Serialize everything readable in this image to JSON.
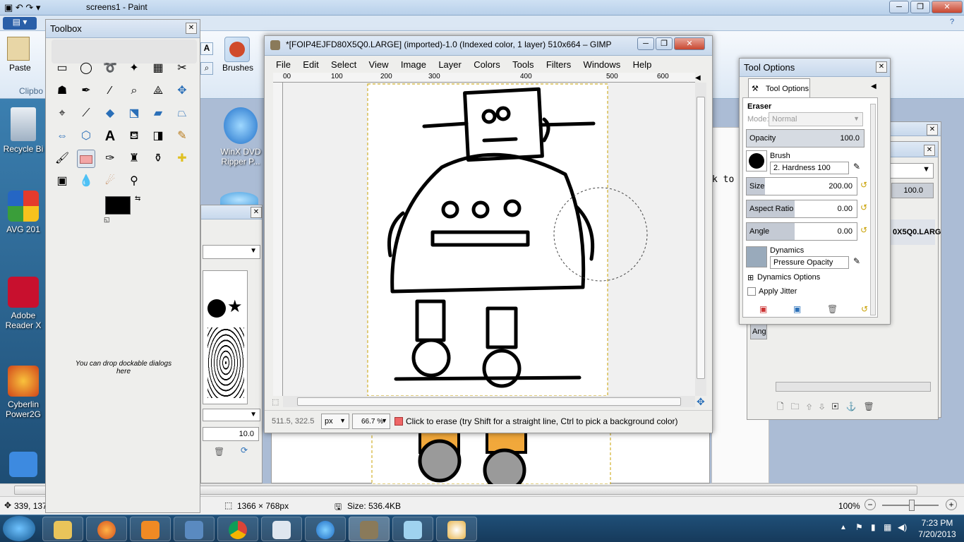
{
  "paint": {
    "title": "screens1 - Paint",
    "tab_home": "",
    "paste_label": "Paste",
    "clipboard_label": "Clipbo",
    "brushes_label": "Brushes",
    "status_cursor": "339, 137",
    "status_size": "1366 × 768px",
    "status_filesize": "Size: 536.4KB",
    "zoom": "100%"
  },
  "desktop": {
    "icons": [
      {
        "label": "Recycle Bi"
      },
      {
        "label": "AVG 201"
      },
      {
        "label": "Adobe Reader X"
      },
      {
        "label": "Cyberlin Power2G"
      }
    ],
    "winx_label": "WinX DVD Ripper P..."
  },
  "toolbox": {
    "title": "Toolbox",
    "drop_hint": "You can drop dockable dialogs here"
  },
  "gimp": {
    "title": "*[FOIP4EJFD80X5Q0.LARGE] (imported)-1.0 (Indexed color, 1 layer) 510x664 – GIMP",
    "menu": [
      "File",
      "Edit",
      "Select",
      "View",
      "Image",
      "Layer",
      "Colors",
      "Tools",
      "Filters",
      "Windows",
      "Help"
    ],
    "ruler_h": [
      "00",
      "100",
      "200",
      "300",
      "400",
      "500",
      "600"
    ],
    "coords": "511.5, 322.5",
    "unit": "px",
    "zoom": "66.7 %",
    "status": "Click to erase (try Shift for a straight line, Ctrl to pick a background color)"
  },
  "tool_options": {
    "window_title": "Tool Options",
    "tab_label": "Tool Options",
    "tool_name": "Eraser",
    "mode_label": "Mode:",
    "mode_value": "Normal",
    "opacity_label": "Opacity",
    "opacity_value": "100.0",
    "brush_label": "Brush",
    "brush_value": "2. Hardness 100",
    "size_label": "Size",
    "size_value": "200.00",
    "aspect_label": "Aspect Ratio",
    "aspect_value": "0.00",
    "angle_label": "Angle",
    "angle_value": "0.00",
    "dynamics_label": "Dynamics",
    "dynamics_value": "Pressure Opacity",
    "dynamics_options": "Dynamics Options",
    "apply_jitter": "Apply Jitter"
  },
  "layers_panel": {
    "value": "100.0",
    "layer_name": "0X5Q0.LARG",
    "ang": "Ang",
    "text_fragment": "k to"
  },
  "brushes_panel": {
    "spacing": "10.0"
  },
  "taskbar": {
    "time": "7:23 PM",
    "date": "7/20/2013"
  },
  "colors": {
    "accent": "#3a6ea5",
    "fg_color": "#000000",
    "bg_color": "#ffffff"
  }
}
